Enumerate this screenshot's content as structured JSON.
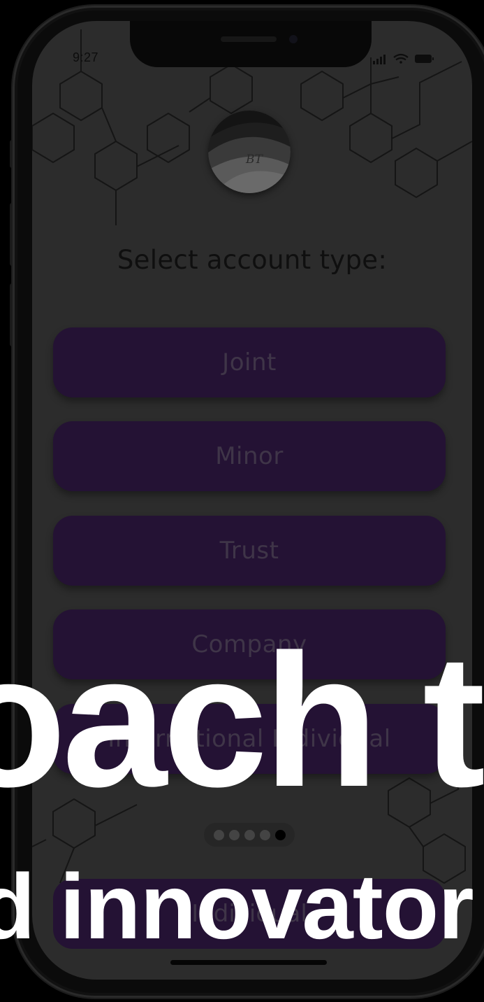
{
  "status_bar": {
    "time": "9:27"
  },
  "logo": {
    "initials": "BT"
  },
  "heading": "Select account type:",
  "account_types": [
    {
      "label": "Joint"
    },
    {
      "label": "Minor"
    },
    {
      "label": "Trust"
    },
    {
      "label": "Company"
    },
    {
      "label": "International Individual"
    }
  ],
  "pager": {
    "total_pages": 5,
    "active_page": 5
  },
  "bottom_button": {
    "label": "Individual"
  },
  "overlay": {
    "big_text": "oach t",
    "sub_text": "d innovator"
  },
  "colors": {
    "button_fill": "#241234",
    "screen_dim": "#2c2c2c",
    "overlay_text": "#ffffff"
  },
  "icons": [
    "signal-icon",
    "wifi-icon",
    "battery-icon"
  ]
}
